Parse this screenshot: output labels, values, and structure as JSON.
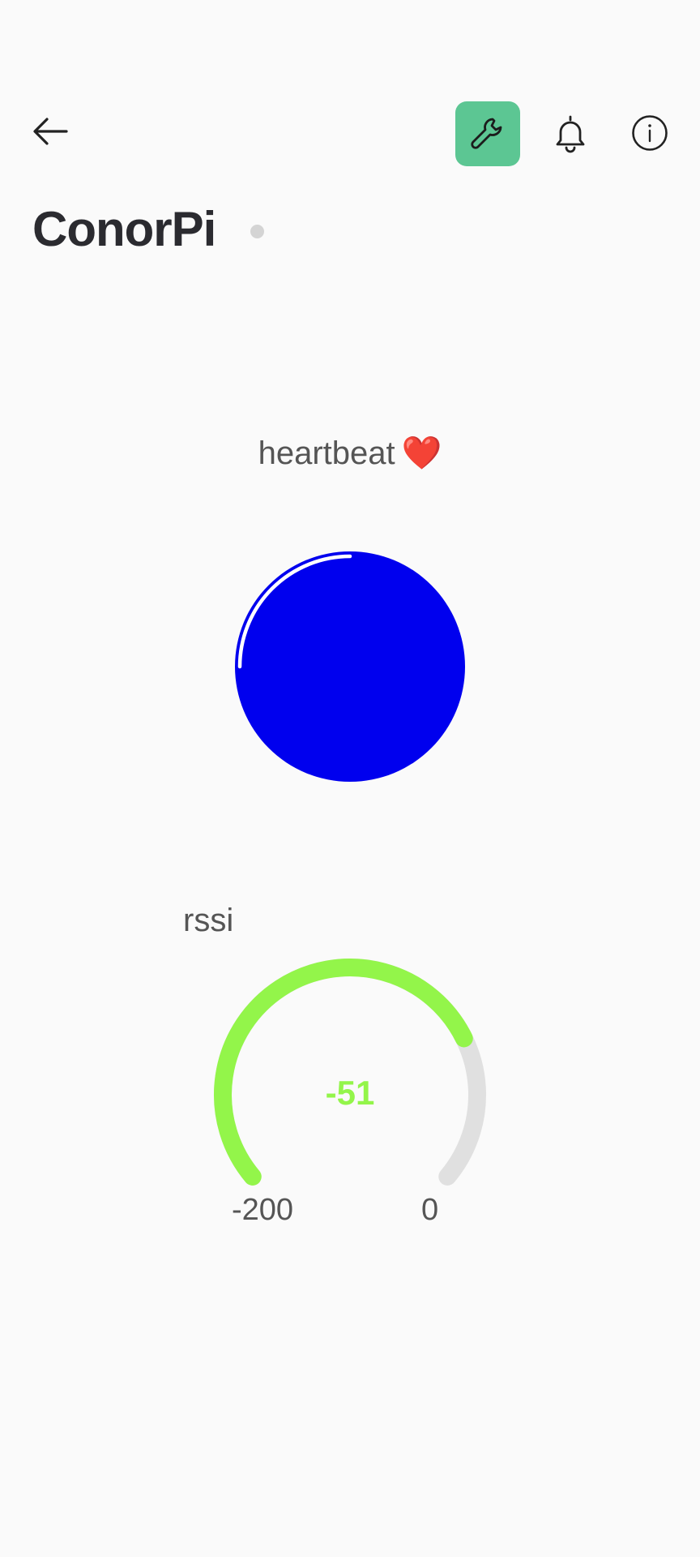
{
  "header": {
    "device_name": "ConorPi",
    "icons": {
      "back": "arrow-left-icon",
      "settings": "wrench-icon",
      "notifications": "bell-icon",
      "info": "info-icon"
    },
    "settings_active_color": "#5cc693",
    "status_dot_color": "#d4d4d4"
  },
  "heartbeat": {
    "label": "heartbeat",
    "emoji": "❤️",
    "fill_color": "#0000ee",
    "ring_color": "#ffffff"
  },
  "rssi": {
    "label": "rssi",
    "value": -51,
    "value_text": "-51",
    "min": -200,
    "max": 0,
    "min_text": "-200",
    "max_text": "0",
    "active_color": "#93f54a",
    "track_color": "#e0e0e0"
  }
}
